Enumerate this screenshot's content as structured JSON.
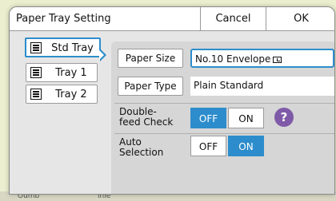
{
  "background": {
    "bottom_left": "Oumb",
    "bottom_mid": "lnle"
  },
  "header": {
    "title": "Paper Tray Setting",
    "cancel_label": "Cancel",
    "ok_label": "OK"
  },
  "trays": [
    {
      "label": "Std Tray",
      "selected": true,
      "icon": "tray-icon"
    },
    {
      "label": "Tray 1",
      "selected": false,
      "icon": "tray-icon"
    },
    {
      "label": "Tray 2",
      "selected": false,
      "icon": "tray-icon"
    }
  ],
  "settings": {
    "paper_size_label": "Paper Size",
    "paper_size_value": "No.10 Envelope",
    "paper_size_icon": "envelope-orientation-icon",
    "paper_type_label": "Paper Type",
    "paper_type_value": "Plain Standard",
    "double_feed_label": "Double-feed Check",
    "double_feed_off": "OFF",
    "double_feed_on": "ON",
    "double_feed_selected": "OFF",
    "help_label": "?",
    "auto_selection_label": "Auto Selection",
    "auto_selection_off": "OFF",
    "auto_selection_on": "ON",
    "auto_selection_selected": "ON"
  },
  "colors": {
    "accent": "#2d8dcc",
    "help": "#7f5aa8",
    "background": "#ecefcf"
  }
}
